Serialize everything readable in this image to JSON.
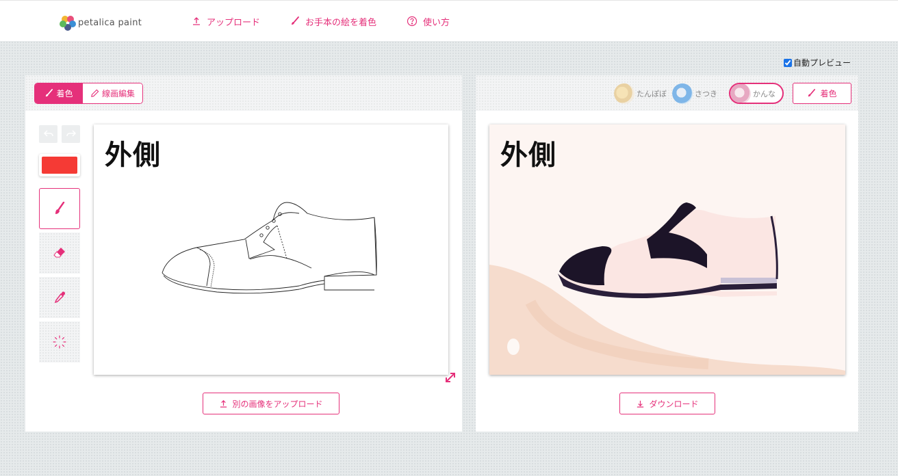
{
  "header": {
    "logo_text": "petalica paint",
    "nav": [
      {
        "label": "アップロード",
        "icon": "upload-icon"
      },
      {
        "label": "お手本の絵を着色",
        "icon": "brush-icon"
      },
      {
        "label": "使い方",
        "icon": "help-circle-icon"
      }
    ]
  },
  "auto_preview": {
    "label": "自動プレビュー",
    "checked": true
  },
  "left_panel": {
    "mode_tabs": [
      {
        "label": "着色",
        "icon": "brush-icon",
        "active": true
      },
      {
        "label": "線画編集",
        "icon": "pencil-icon",
        "active": false
      }
    ],
    "tools": {
      "undo_icon": "undo-icon",
      "redo_icon": "redo-icon",
      "current_color": "#f53a35",
      "items": [
        {
          "name": "brush",
          "icon": "brush-icon",
          "active": true
        },
        {
          "name": "eraser",
          "icon": "eraser-icon",
          "active": false
        },
        {
          "name": "eyedropper",
          "icon": "eyedropper-icon",
          "active": false
        },
        {
          "name": "clear",
          "icon": "sparkle-icon",
          "active": false
        }
      ]
    },
    "canvas_title": "外側",
    "upload_another_label": "別の画像をアップロード"
  },
  "right_panel": {
    "styles": [
      {
        "label": "たんぽぽ",
        "selected": false
      },
      {
        "label": "さつき",
        "selected": false
      },
      {
        "label": "かんな",
        "selected": true
      }
    ],
    "colorize_label": "着色",
    "canvas_title": "外側",
    "download_label": "ダウンロード"
  },
  "colors": {
    "accent": "#e5307a",
    "swatch": "#f53a35"
  }
}
